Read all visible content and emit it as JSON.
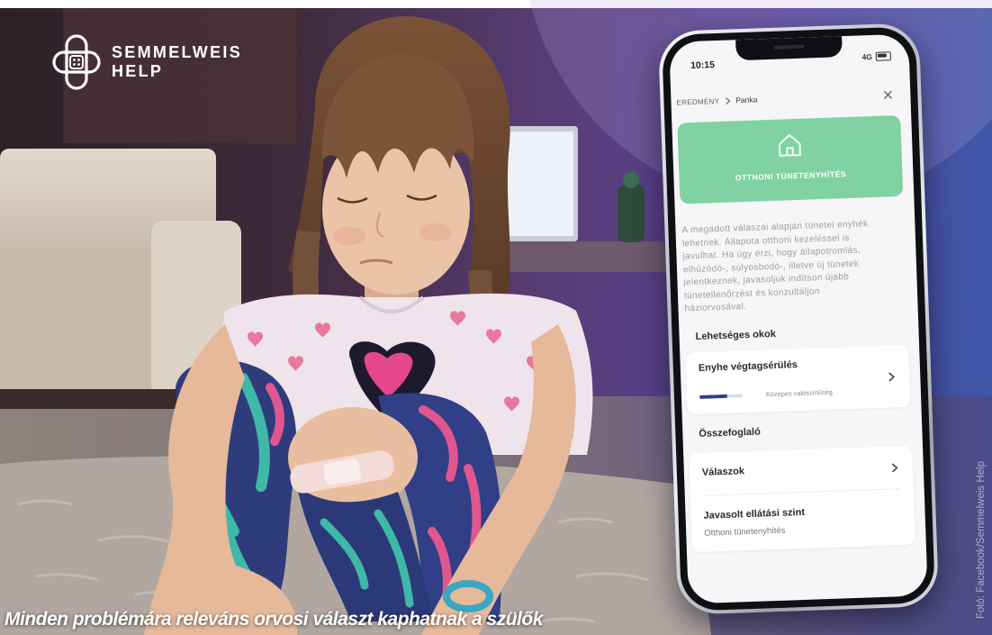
{
  "brand": {
    "name_line1": "SEMMELWEIS",
    "name_line2": "HELP",
    "logo_icon": "rounded-cross-logo-icon"
  },
  "photo": {
    "caption": "Minden problémára releváns orvosi választ kaphatnak a szülők",
    "credit": "Fotó: Facebook/Semmelweis Help"
  },
  "phone": {
    "status": {
      "time": "10:15",
      "network": "4G",
      "battery_icon": "battery-icon"
    },
    "breadcrumb": {
      "parent": "EREDMÉNY",
      "current": "Panka",
      "separator_icon": "chevron-right-icon",
      "close_icon": "close-icon"
    },
    "result": {
      "icon": "house-icon",
      "title": "OTTHONI TÜNETENYHÍTÉS",
      "description_lines": [
        "A megadott válaszai alapján tünetei enyhék",
        "lehetnek. Állapota otthoni kezeléssel is",
        "javulhat. Ha úgy érzi, hogy állapotromlás,",
        "elhúzódó-, súlyosbodó-, illetve új tünetek",
        "jelentkeznek, javasoljuk indítson újabb",
        "tünetellenőrzést és konzultáljon",
        "háziorvosával."
      ]
    },
    "causes": {
      "title": "Lehetséges okok",
      "items": [
        {
          "name": "Enyhe végtagsérülés",
          "probability": 0.65,
          "probability_label": "Közepes valószínűség"
        }
      ]
    },
    "summary": {
      "title": "Összefoglaló",
      "answers_label": "Válaszok",
      "care_level_label": "Javasolt ellátási szint",
      "care_level_value": "Otthoni tünetenyhítés"
    }
  },
  "colors": {
    "result_green": "#80d2a2",
    "probability_fill": "#2c3f8c",
    "background_purple": "#583c76"
  }
}
